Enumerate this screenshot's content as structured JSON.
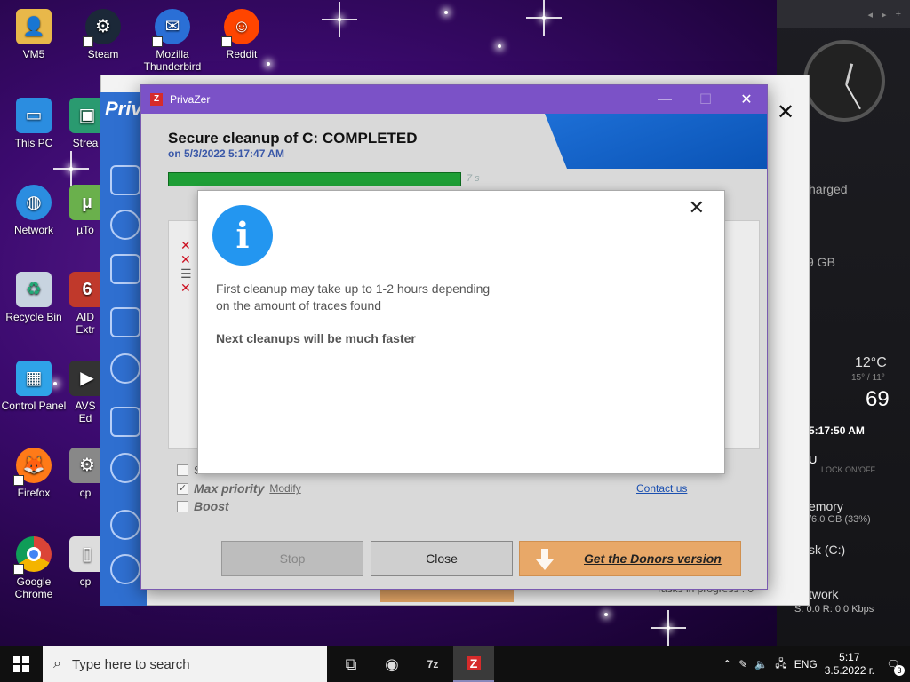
{
  "desktop": {
    "icons": [
      {
        "label": "VM5"
      },
      {
        "label": "Steam"
      },
      {
        "label": "Mozilla Thunderbird"
      },
      {
        "label": "Reddit"
      },
      {
        "label": "This PC"
      },
      {
        "label": "Network"
      },
      {
        "label": "Recycle Bin"
      },
      {
        "label": "Control Panel"
      },
      {
        "label": "Firefox"
      },
      {
        "label": "Google Chrome"
      }
    ],
    "partial_icons": [
      "Strea",
      "µTo",
      "AID Extr",
      "AVS Ed",
      "cp",
      "cp"
    ]
  },
  "widgets": {
    "time_big": "5:17:50 AM",
    "charged": "harged",
    "storage": "9 GB",
    "temp": "12°C",
    "temp_range": "15° / 11°",
    "num": "69",
    "clock_small": "5:17:50 AM",
    "lock": "LOCK ON/OFF",
    "memory_label": "emory",
    "memory_value": "/6.0 GB (33%)",
    "disk_label": "sk (C:)",
    "network_label": "twork",
    "network_value": "S: 0.0  R: 0.0 Kbps",
    "tasks": "Tasks in progress : 0"
  },
  "back_window": {
    "logo": "Priv"
  },
  "window": {
    "title": "PrivaZer",
    "logo_letter": "Z",
    "heading": "Secure cleanup of C: COMPLETED",
    "subheading": "on 5/3/2022 5:17:47 AM",
    "progress_label": "7 s",
    "progress": 1.0,
    "options": [
      {
        "label": "S",
        "checked": false
      },
      {
        "label": "Max priority",
        "link": "Modify",
        "checked": true
      },
      {
        "label": "Boost",
        "checked": false
      }
    ],
    "contact_link": "Contact us",
    "buttons": {
      "stop": "Stop",
      "close": "Close",
      "donors": "Get the Donors version"
    }
  },
  "modal": {
    "line1": "First cleanup may take up to 1-2 hours depending",
    "line2": "on the amount of traces found",
    "strong": "Next cleanups will be much faster"
  },
  "taskbar": {
    "search_placeholder": "Type here to search",
    "lang": "ENG",
    "time": "5:17",
    "date": "3.5.2022 г.",
    "notifications": "3"
  },
  "colors": {
    "titlebar": "#7b52c7",
    "progress": "#1e9e36",
    "info": "#2396f0",
    "donors": "#e8a868"
  }
}
